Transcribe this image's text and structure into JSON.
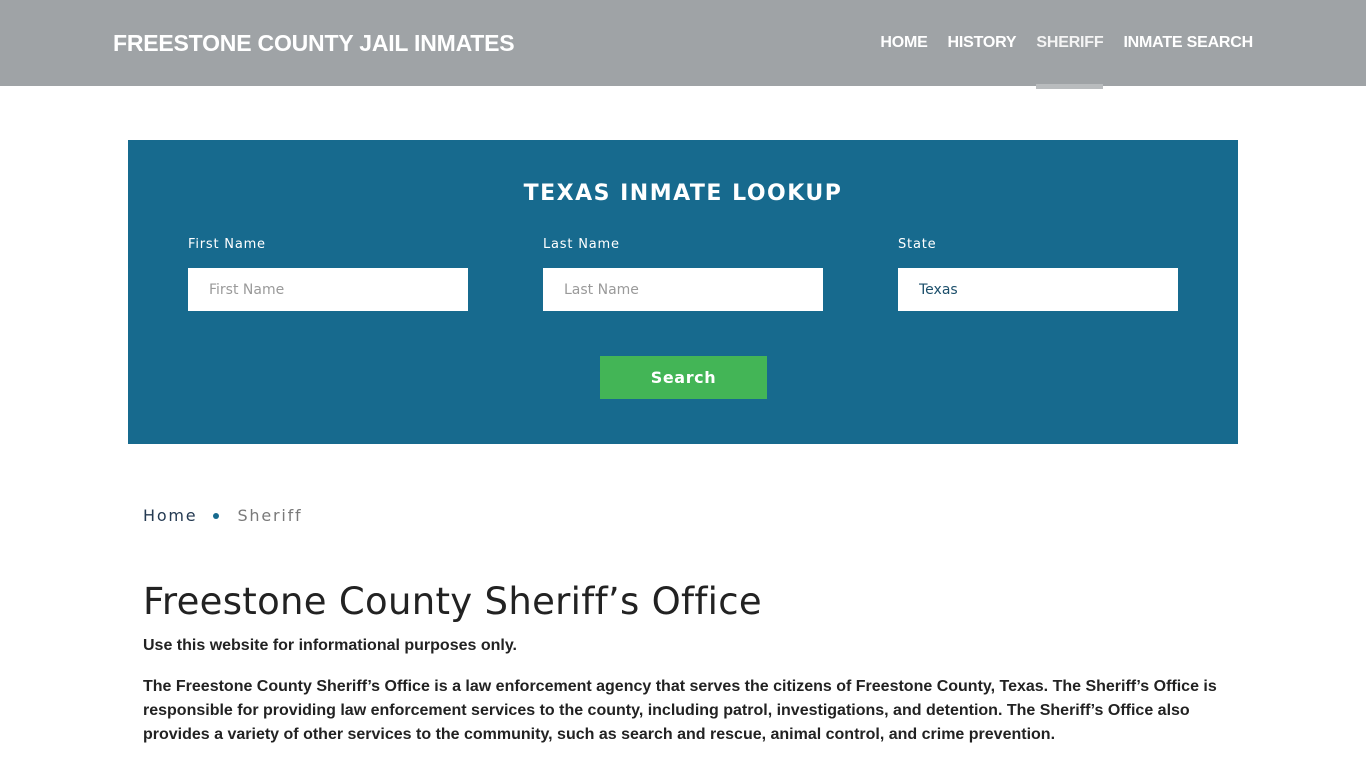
{
  "header": {
    "brand": "FREESTONE COUNTY JAIL INMATES",
    "nav": [
      {
        "label": "HOME",
        "active": false
      },
      {
        "label": "HISTORY",
        "active": false
      },
      {
        "label": "SHERIFF",
        "active": true
      },
      {
        "label": "INMATE SEARCH",
        "active": false
      }
    ]
  },
  "lookup": {
    "title": "TEXAS INMATE LOOKUP",
    "first_name": {
      "label": "First Name",
      "placeholder": "First Name",
      "value": ""
    },
    "last_name": {
      "label": "Last Name",
      "placeholder": "Last Name",
      "value": ""
    },
    "state": {
      "label": "State",
      "value": "Texas"
    },
    "search_label": "Search",
    "colors": {
      "panel": "#176a8e",
      "button": "#43b556"
    }
  },
  "breadcrumb": {
    "items": [
      {
        "label": "Home"
      },
      {
        "label": "Sheriff"
      }
    ]
  },
  "main": {
    "title": "Freestone County Sheriff’s Office",
    "disclaimer": "Use this website for informational purposes only.",
    "paragraph": "The Freestone County Sheriff’s Office is a law enforcement agency that serves the citizens of Freestone County, Texas. The Sheriff’s Office is responsible for providing law enforcement services to the county, including patrol, investigations, and detention. The Sheriff’s Office also provides a variety of other services to the community, such as search and rescue, animal control, and crime prevention."
  }
}
